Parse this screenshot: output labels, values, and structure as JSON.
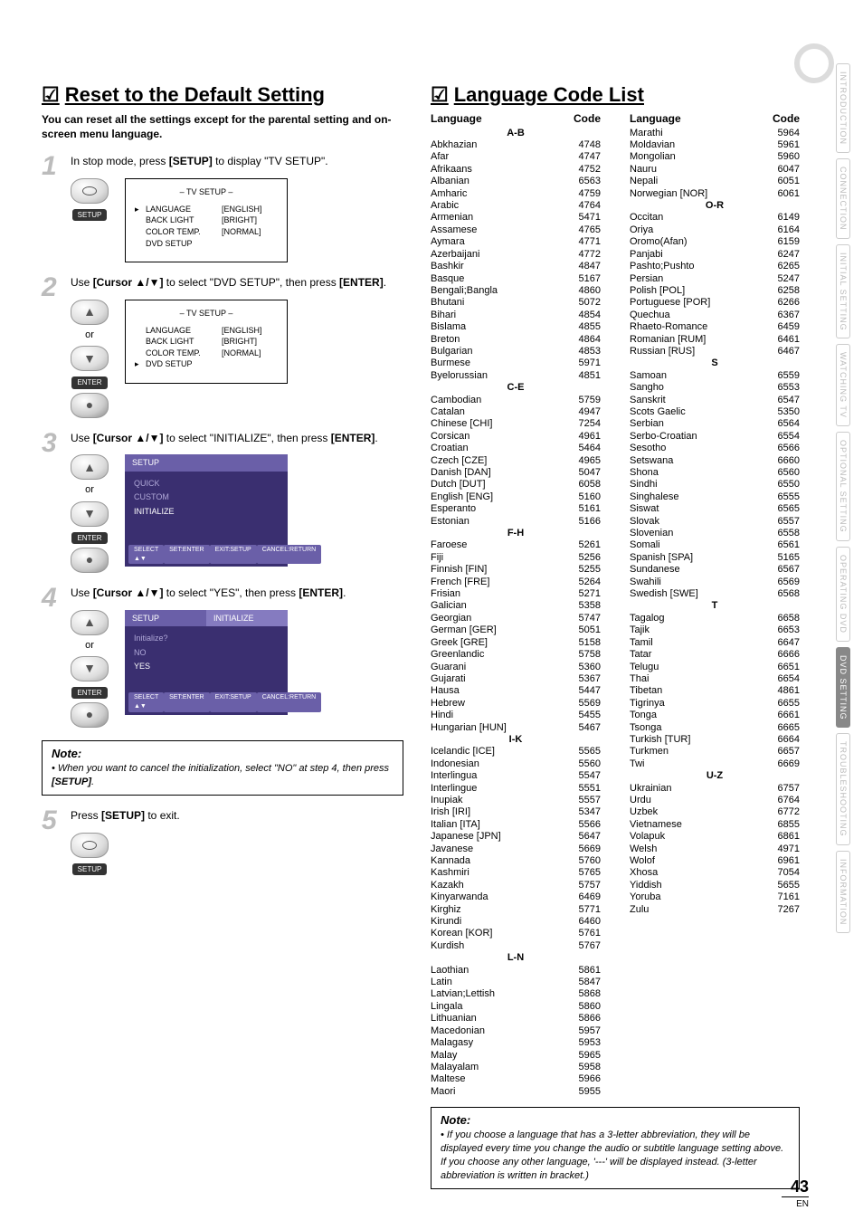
{
  "side_tabs": [
    "INTRODUCTION",
    "CONNECTION",
    "INITIAL SETTING",
    "WATCHING TV",
    "OPTIONAL SETTING",
    "OPERATING DVD",
    "DVD SETTING",
    "TROUBLESHOOTING",
    "INFORMATION"
  ],
  "side_tab_active_index": 6,
  "reset": {
    "title": "Reset to the Default Setting",
    "intro": "You can reset all the settings except for the parental setting and on-screen menu language.",
    "steps": [
      {
        "num": "1",
        "text_pre": "In stop mode, press ",
        "bold1": "[SETUP]",
        "text_post": " to display \"TV SETUP\"."
      },
      {
        "num": "2",
        "text_pre": "Use ",
        "bold1": "[Cursor ▲/▼]",
        "text_mid": " to select \"DVD SETUP\", then press ",
        "bold2": "[ENTER]",
        "text_post": "."
      },
      {
        "num": "3",
        "text_pre": "Use ",
        "bold1": "[Cursor ▲/▼]",
        "text_mid": " to select \"INITIALIZE\", then press ",
        "bold2": "[ENTER]",
        "text_post": "."
      },
      {
        "num": "4",
        "text_pre": "Use ",
        "bold1": "[Cursor ▲/▼]",
        "text_mid": " to select \"YES\", then press ",
        "bold2": "[ENTER]",
        "text_post": "."
      },
      {
        "num": "5",
        "text_pre": "Press ",
        "bold1": "[SETUP]",
        "text_post": " to exit."
      }
    ],
    "tv_setup": {
      "title": "– TV SETUP –",
      "rows": [
        {
          "label": "LANGUAGE",
          "val": "[ENGLISH]"
        },
        {
          "label": "BACK LIGHT",
          "val": "[BRIGHT]"
        },
        {
          "label": "COLOR TEMP.",
          "val": "[NORMAL]"
        },
        {
          "label": "DVD SETUP",
          "val": ""
        }
      ]
    },
    "purple1": {
      "header": "SETUP",
      "items": [
        "QUICK",
        "CUSTOM",
        "INITIALIZE"
      ],
      "footer": [
        "SELECT ▲▼",
        "SET:ENTER",
        "EXIT:SETUP",
        "CANCEL:RETURN"
      ]
    },
    "purple2": {
      "header": "SETUP",
      "header2": "INITIALIZE",
      "prompt": "Initialize?",
      "items": [
        "NO",
        "YES"
      ],
      "footer": [
        "SELECT ▲▼",
        "SET:ENTER",
        "EXIT:SETUP",
        "CANCEL:RETURN"
      ]
    },
    "labels": {
      "or": "or",
      "setup": "SETUP",
      "enter": "ENTER"
    },
    "note": {
      "title": "Note:",
      "body": "• When you want to cancel the initialization, select \"NO\" at step 4, then press [SETUP]."
    }
  },
  "lang": {
    "title": "Language Code List",
    "head_lang": "Language",
    "head_code": "Code",
    "col1": [
      {
        "sub": "A-B"
      },
      {
        "n": "Abkhazian",
        "c": "4748"
      },
      {
        "n": "Afar",
        "c": "4747"
      },
      {
        "n": "Afrikaans",
        "c": "4752"
      },
      {
        "n": "Albanian",
        "c": "6563"
      },
      {
        "n": "Amharic",
        "c": "4759"
      },
      {
        "n": "Arabic",
        "c": "4764"
      },
      {
        "n": "Armenian",
        "c": "5471"
      },
      {
        "n": "Assamese",
        "c": "4765"
      },
      {
        "n": "Aymara",
        "c": "4771"
      },
      {
        "n": "Azerbaijani",
        "c": "4772"
      },
      {
        "n": "Bashkir",
        "c": "4847"
      },
      {
        "n": "Basque",
        "c": "5167"
      },
      {
        "n": "Bengali;Bangla",
        "c": "4860"
      },
      {
        "n": "Bhutani",
        "c": "5072"
      },
      {
        "n": "Bihari",
        "c": "4854"
      },
      {
        "n": "Bislama",
        "c": "4855"
      },
      {
        "n": "Breton",
        "c": "4864"
      },
      {
        "n": "Bulgarian",
        "c": "4853"
      },
      {
        "n": "Burmese",
        "c": "5971"
      },
      {
        "n": "Byelorussian",
        "c": "4851"
      },
      {
        "sub": "C-E"
      },
      {
        "n": "Cambodian",
        "c": "5759"
      },
      {
        "n": "Catalan",
        "c": "4947"
      },
      {
        "n": "Chinese [CHI]",
        "c": "7254"
      },
      {
        "n": "Corsican",
        "c": "4961"
      },
      {
        "n": "Croatian",
        "c": "5464"
      },
      {
        "n": "Czech [CZE]",
        "c": "4965"
      },
      {
        "n": "Danish [DAN]",
        "c": "5047"
      },
      {
        "n": "Dutch [DUT]",
        "c": "6058"
      },
      {
        "n": "English [ENG]",
        "c": "5160"
      },
      {
        "n": "Esperanto",
        "c": "5161"
      },
      {
        "n": "Estonian",
        "c": "5166"
      },
      {
        "sub": "F-H"
      },
      {
        "n": "Faroese",
        "c": "5261"
      },
      {
        "n": "Fiji",
        "c": "5256"
      },
      {
        "n": "Finnish [FIN]",
        "c": "5255"
      },
      {
        "n": "French [FRE]",
        "c": "5264"
      },
      {
        "n": "Frisian",
        "c": "5271"
      },
      {
        "n": "Galician",
        "c": "5358"
      },
      {
        "n": "Georgian",
        "c": "5747"
      },
      {
        "n": "German [GER]",
        "c": "5051"
      },
      {
        "n": "Greek [GRE]",
        "c": "5158"
      },
      {
        "n": "Greenlandic",
        "c": "5758"
      },
      {
        "n": "Guarani",
        "c": "5360"
      },
      {
        "n": "Gujarati",
        "c": "5367"
      },
      {
        "n": "Hausa",
        "c": "5447"
      },
      {
        "n": "Hebrew",
        "c": "5569"
      },
      {
        "n": "Hindi",
        "c": "5455"
      },
      {
        "n": "Hungarian [HUN]",
        "c": "5467"
      },
      {
        "sub": "I-K"
      },
      {
        "n": "Icelandic [ICE]",
        "c": "5565"
      },
      {
        "n": "Indonesian",
        "c": "5560"
      },
      {
        "n": "Interlingua",
        "c": "5547"
      },
      {
        "n": "Interlingue",
        "c": "5551"
      },
      {
        "n": "Inupiak",
        "c": "5557"
      },
      {
        "n": "Irish [IRI]",
        "c": "5347"
      },
      {
        "n": "Italian [ITA]",
        "c": "5566"
      },
      {
        "n": "Japanese [JPN]",
        "c": "5647"
      },
      {
        "n": "Javanese",
        "c": "5669"
      },
      {
        "n": "Kannada",
        "c": "5760"
      },
      {
        "n": "Kashmiri",
        "c": "5765"
      },
      {
        "n": "Kazakh",
        "c": "5757"
      },
      {
        "n": "Kinyarwanda",
        "c": "6469"
      },
      {
        "n": "Kirghiz",
        "c": "5771"
      },
      {
        "n": "Kirundi",
        "c": "6460"
      },
      {
        "n": "Korean [KOR]",
        "c": "5761"
      },
      {
        "n": "Kurdish",
        "c": "5767"
      },
      {
        "sub": "L-N"
      },
      {
        "n": "Laothian",
        "c": "5861"
      },
      {
        "n": "Latin",
        "c": "5847"
      },
      {
        "n": "Latvian;Lettish",
        "c": "5868"
      },
      {
        "n": "Lingala",
        "c": "5860"
      },
      {
        "n": "Lithuanian",
        "c": "5866"
      },
      {
        "n": "Macedonian",
        "c": "5957"
      },
      {
        "n": "Malagasy",
        "c": "5953"
      },
      {
        "n": "Malay",
        "c": "5965"
      },
      {
        "n": "Malayalam",
        "c": "5958"
      },
      {
        "n": "Maltese",
        "c": "5966"
      },
      {
        "n": "Maori",
        "c": "5955"
      }
    ],
    "col2": [
      {
        "n": "Marathi",
        "c": "5964"
      },
      {
        "n": "Moldavian",
        "c": "5961"
      },
      {
        "n": "Mongolian",
        "c": "5960"
      },
      {
        "n": "Nauru",
        "c": "6047"
      },
      {
        "n": "Nepali",
        "c": "6051"
      },
      {
        "n": "Norwegian [NOR]",
        "c": "6061"
      },
      {
        "sub": "O-R"
      },
      {
        "n": "Occitan",
        "c": "6149"
      },
      {
        "n": "Oriya",
        "c": "6164"
      },
      {
        "n": "Oromo(Afan)",
        "c": "6159"
      },
      {
        "n": "Panjabi",
        "c": "6247"
      },
      {
        "n": "Pashto;Pushto",
        "c": "6265"
      },
      {
        "n": "Persian",
        "c": "5247"
      },
      {
        "n": "Polish [POL]",
        "c": "6258"
      },
      {
        "n": "Portuguese [POR]",
        "c": "6266"
      },
      {
        "n": "Quechua",
        "c": "6367"
      },
      {
        "n": "Rhaeto-Romance",
        "c": "6459"
      },
      {
        "n": "Romanian [RUM]",
        "c": "6461"
      },
      {
        "n": "Russian [RUS]",
        "c": "6467"
      },
      {
        "sub": "S"
      },
      {
        "n": "Samoan",
        "c": "6559"
      },
      {
        "n": "Sangho",
        "c": "6553"
      },
      {
        "n": "Sanskrit",
        "c": "6547"
      },
      {
        "n": "Scots Gaelic",
        "c": "5350"
      },
      {
        "n": "Serbian",
        "c": "6564"
      },
      {
        "n": "Serbo-Croatian",
        "c": "6554"
      },
      {
        "n": "Sesotho",
        "c": "6566"
      },
      {
        "n": "Setswana",
        "c": "6660"
      },
      {
        "n": "Shona",
        "c": "6560"
      },
      {
        "n": "Sindhi",
        "c": "6550"
      },
      {
        "n": "Singhalese",
        "c": "6555"
      },
      {
        "n": "Siswat",
        "c": "6565"
      },
      {
        "n": "Slovak",
        "c": "6557"
      },
      {
        "n": "Slovenian",
        "c": "6558"
      },
      {
        "n": "Somali",
        "c": "6561"
      },
      {
        "n": "Spanish [SPA]",
        "c": "5165"
      },
      {
        "n": "Sundanese",
        "c": "6567"
      },
      {
        "n": "Swahili",
        "c": "6569"
      },
      {
        "n": "Swedish [SWE]",
        "c": "6568"
      },
      {
        "sub": "T"
      },
      {
        "n": "Tagalog",
        "c": "6658"
      },
      {
        "n": "Tajik",
        "c": "6653"
      },
      {
        "n": "Tamil",
        "c": "6647"
      },
      {
        "n": "Tatar",
        "c": "6666"
      },
      {
        "n": "Telugu",
        "c": "6651"
      },
      {
        "n": "Thai",
        "c": "6654"
      },
      {
        "n": "Tibetan",
        "c": "4861"
      },
      {
        "n": "Tigrinya",
        "c": "6655"
      },
      {
        "n": "Tonga",
        "c": "6661"
      },
      {
        "n": "Tsonga",
        "c": "6665"
      },
      {
        "n": "Turkish [TUR]",
        "c": "6664"
      },
      {
        "n": "Turkmen",
        "c": "6657"
      },
      {
        "n": "Twi",
        "c": "6669"
      },
      {
        "sub": "U-Z"
      },
      {
        "n": "Ukrainian",
        "c": "6757"
      },
      {
        "n": "Urdu",
        "c": "6764"
      },
      {
        "n": "Uzbek",
        "c": "6772"
      },
      {
        "n": "Vietnamese",
        "c": "6855"
      },
      {
        "n": "Volapuk",
        "c": "6861"
      },
      {
        "n": "Welsh",
        "c": "4971"
      },
      {
        "n": "Wolof",
        "c": "6961"
      },
      {
        "n": "Xhosa",
        "c": "7054"
      },
      {
        "n": "Yiddish",
        "c": "5655"
      },
      {
        "n": "Yoruba",
        "c": "7161"
      },
      {
        "n": "Zulu",
        "c": "7267"
      }
    ],
    "note": {
      "title": "Note:",
      "body": "• If you choose a language that has a 3-letter abbreviation, they will be displayed every time you change the audio or subtitle language setting above. If you choose any other language, '---' will be displayed instead. (3-letter abbreviation is written in bracket.)"
    }
  },
  "page_num": "43",
  "page_en": "EN"
}
